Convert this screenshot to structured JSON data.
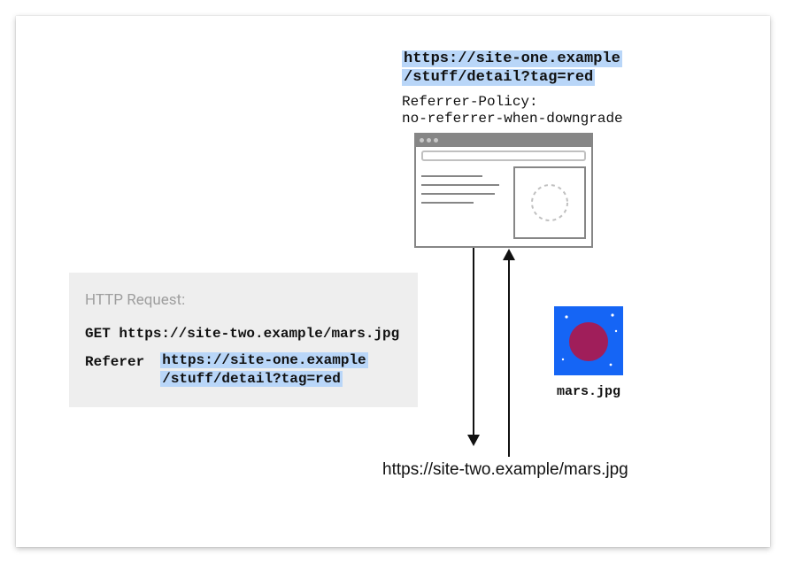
{
  "site_one": {
    "url_line1": "https://site-one.example",
    "url_line2": "/stuff/detail?tag=red",
    "policy_line1": "Referrer-Policy:",
    "policy_line2": "no-referrer-when-downgrade"
  },
  "http": {
    "title": "HTTP Request:",
    "get_line": "GET https://site-two.example/mars.jpg",
    "referer_label": "Referer",
    "referer_url_line1": "https://site-one.example",
    "referer_url_line2": "/stuff/detail?tag=red"
  },
  "mars": {
    "label": "mars.jpg"
  },
  "site_two": {
    "url": "https://site-two.example/mars.jpg"
  }
}
